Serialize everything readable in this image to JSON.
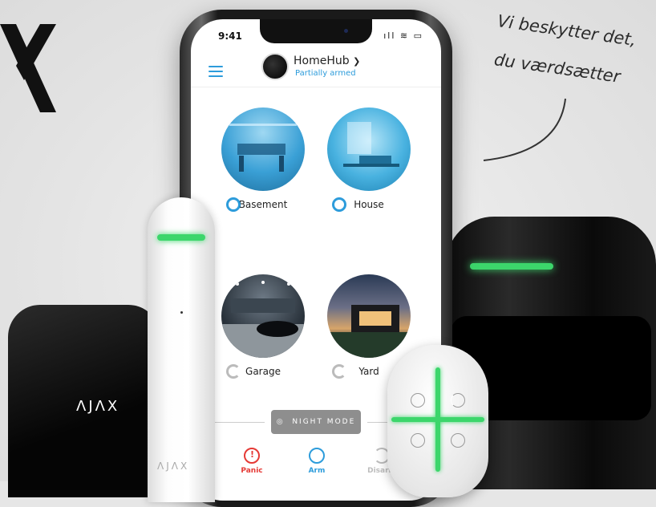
{
  "tagline": {
    "line1": "Vi beskytter det,",
    "line2": "du værdsætter"
  },
  "phone": {
    "status": {
      "time": "9:41",
      "icons": "ıll ≋ ▭"
    },
    "header": {
      "hub_name": "HomeHub",
      "hub_state": "Partially armed",
      "dropdown_icon": "chevron-down-icon"
    },
    "rooms": [
      {
        "label": "Basement",
        "armed": true
      },
      {
        "label": "House",
        "armed": true
      },
      {
        "label": "Garage",
        "armed": false
      },
      {
        "label": "Yard",
        "armed": false
      }
    ],
    "night_mode": "NIGHT MODE",
    "buttons": [
      {
        "label": "Panic",
        "color": "#e53935"
      },
      {
        "label": "Arm",
        "color": "#2d9cdb"
      },
      {
        "label": "Disarm",
        "color": "#bdbdbd"
      }
    ]
  },
  "devices": {
    "hub_logo": "ΛJΛX",
    "sensor_logo": "ΛJΛX"
  },
  "colors": {
    "accent": "#2d9cdb",
    "led_green": "#3cd66b"
  }
}
